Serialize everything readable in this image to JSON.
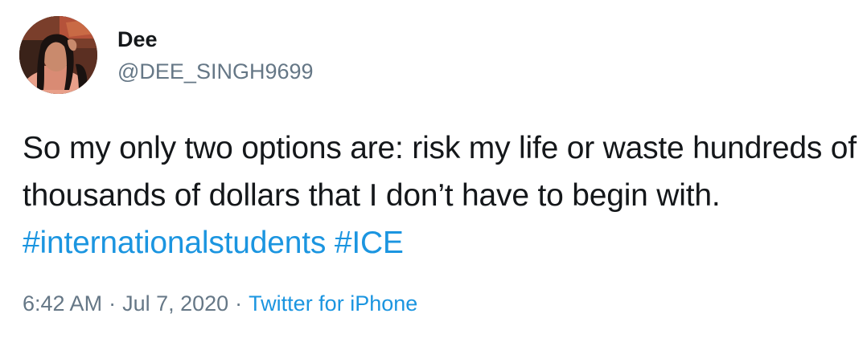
{
  "author": {
    "display_name": "Dee",
    "handle": "@DEE_SINGH9699"
  },
  "tweet": {
    "text_before": "So my only two options are: risk my life or waste hundreds of thousands of dollars that I don’t have to begin with. ",
    "hashtags": [
      "#internationalstudents",
      "#ICE"
    ],
    "time": "6:42 AM",
    "date": "Jul 7, 2020",
    "source": "Twitter for iPhone",
    "separator": "·"
  },
  "colors": {
    "link": "#1b95e0",
    "muted": "#657786",
    "text": "#14171a"
  }
}
